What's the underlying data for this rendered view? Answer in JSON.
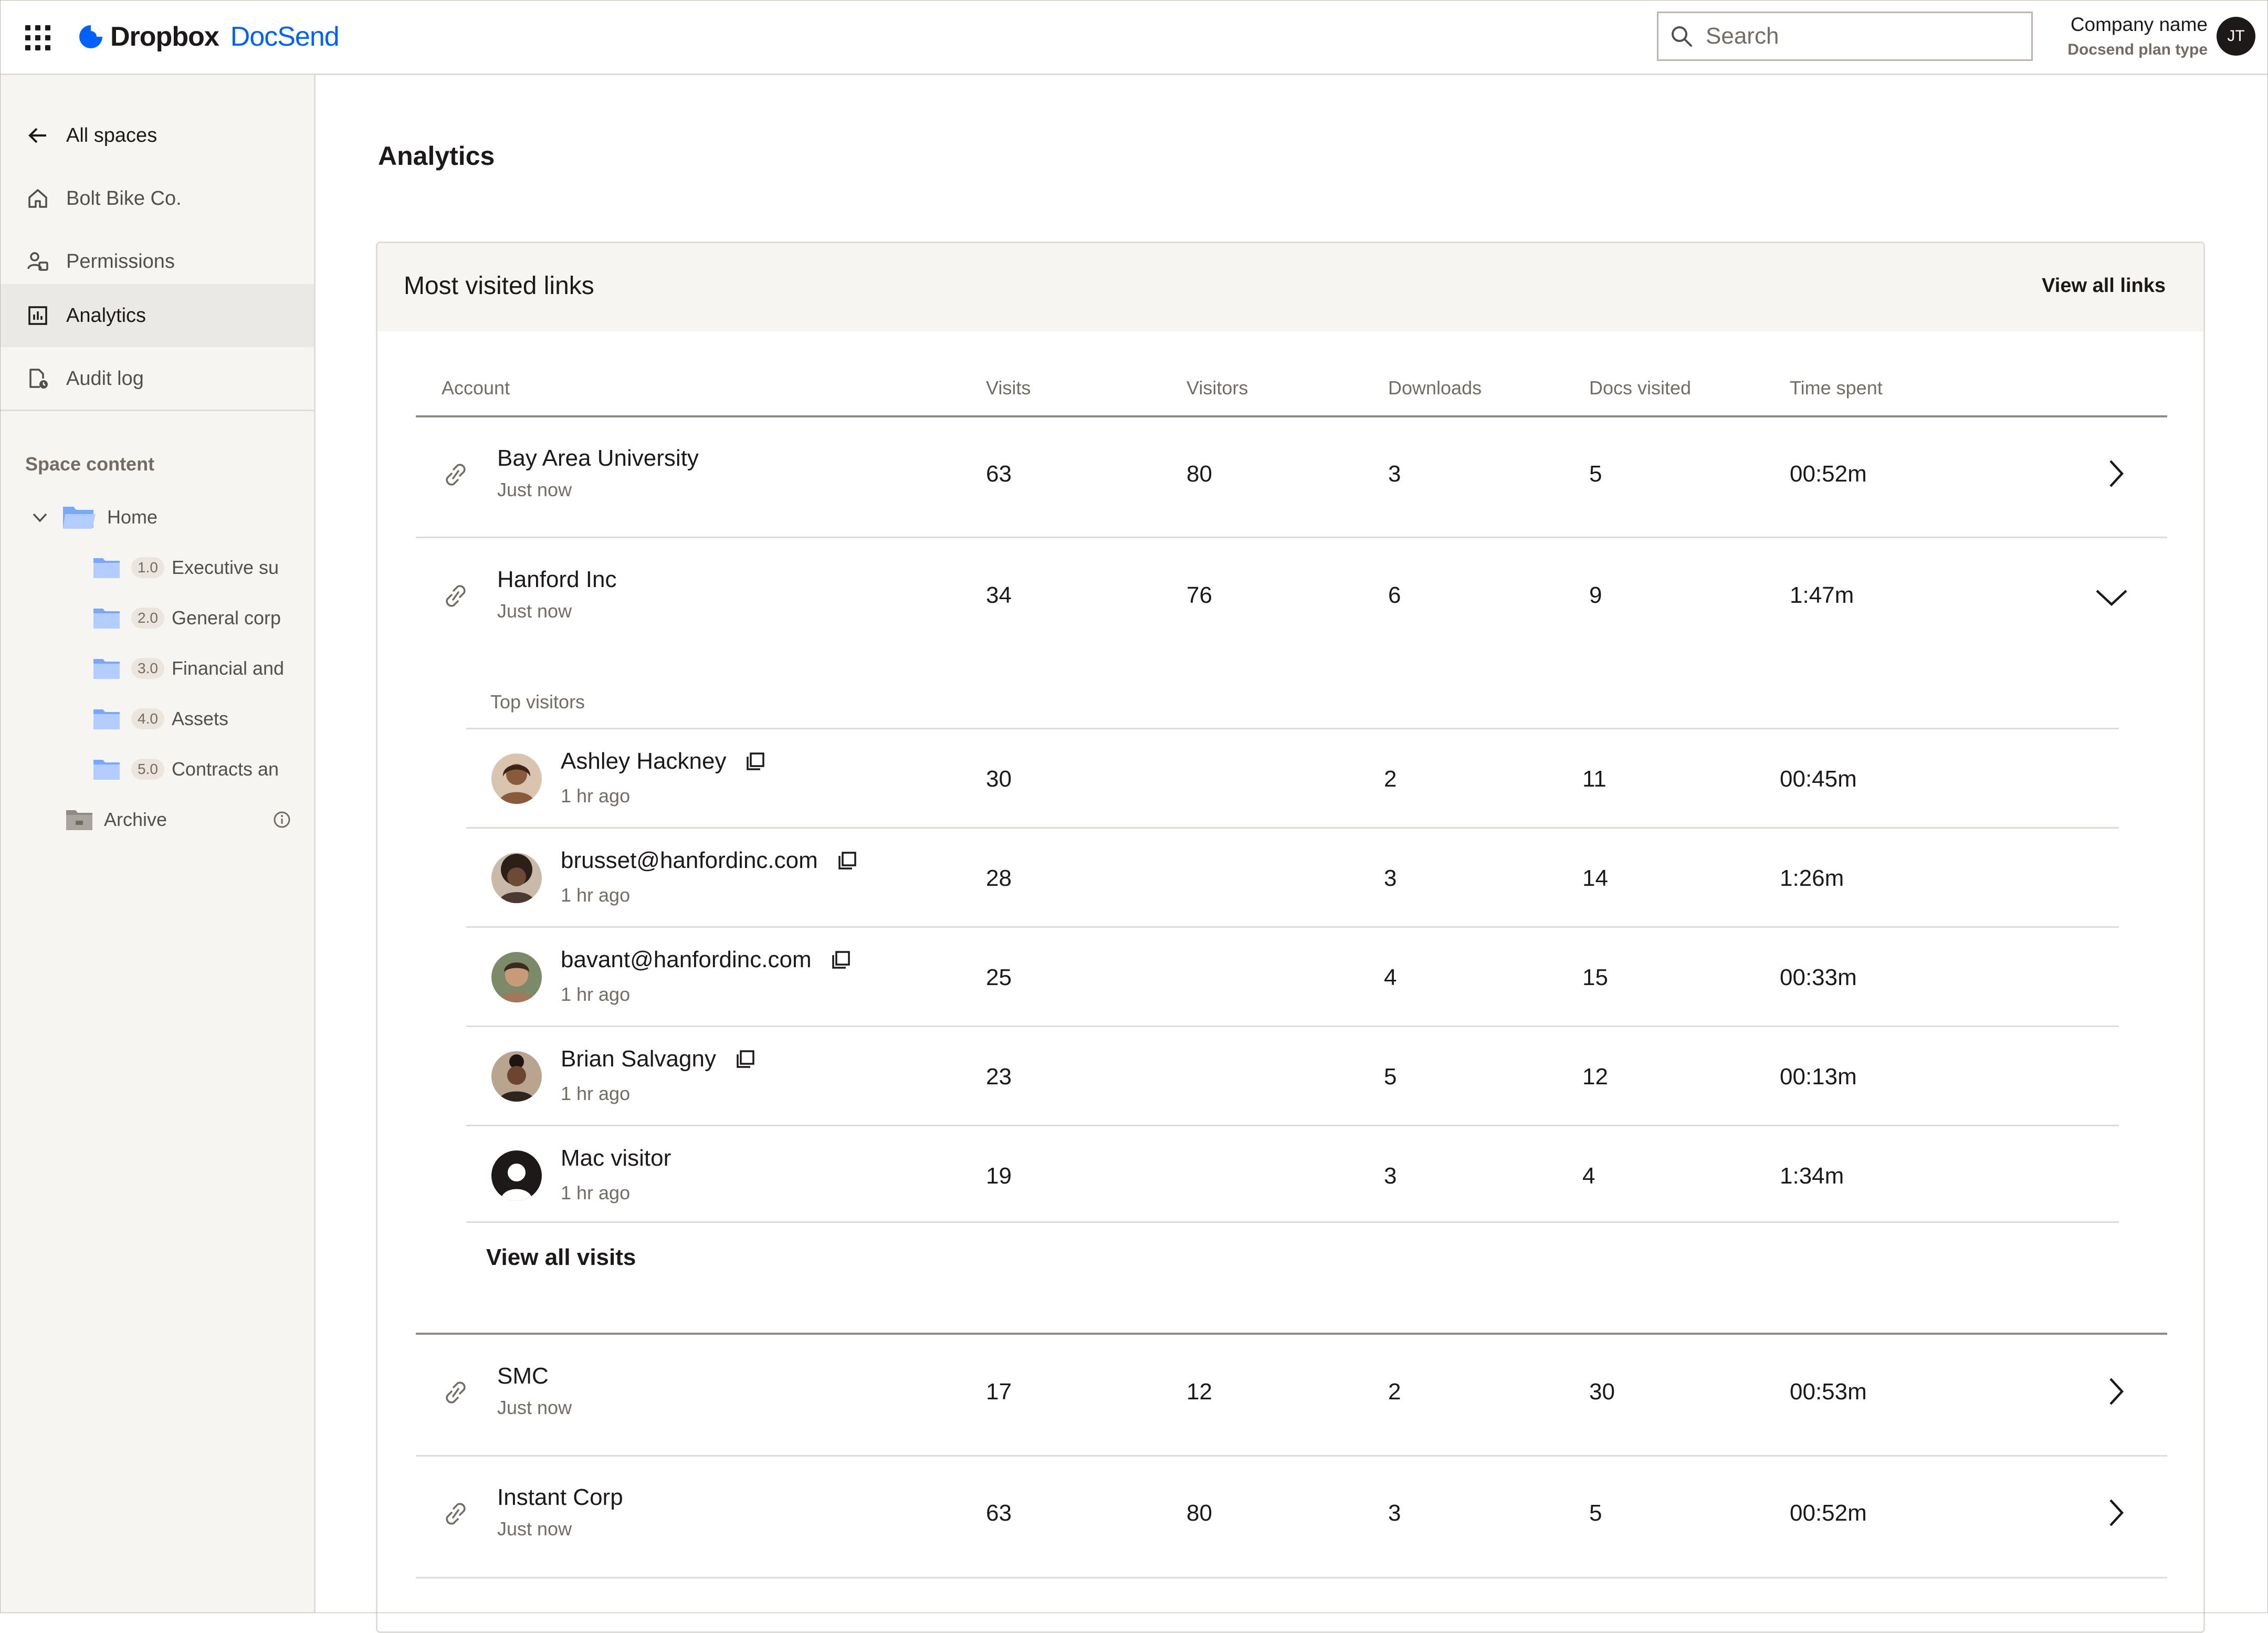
{
  "header": {
    "brand": "Dropbox",
    "product": "DocSend",
    "search_placeholder": "Search",
    "company_name": "Company name",
    "plan_type": "Docsend plan type",
    "user_initials": "JT",
    "brand_color": "#0061fe"
  },
  "sidebar": {
    "back_label": "All spaces",
    "items": [
      {
        "label": "Bolt Bike Co.",
        "icon": "home-icon"
      },
      {
        "label": "Permissions",
        "icon": "people-icon"
      },
      {
        "label": "Analytics",
        "icon": "chart-icon",
        "active": true
      },
      {
        "label": "Audit log",
        "icon": "document-clock-icon"
      }
    ],
    "space_content_title": "Space content",
    "home_label": "Home",
    "folders": [
      {
        "number": "1.0",
        "name": "Executive su"
      },
      {
        "number": "2.0",
        "name": "General corp"
      },
      {
        "number": "3.0",
        "name": "Financial and"
      },
      {
        "number": "4.0",
        "name": "Assets"
      },
      {
        "number": "5.0",
        "name": "Contracts an"
      }
    ],
    "archive_label": "Archive"
  },
  "main": {
    "title": "Analytics",
    "card_title": "Most visited links",
    "view_all_links": "View all links",
    "columns": [
      "Account",
      "Visits",
      "Visitors",
      "Downloads",
      "Docs visited",
      "Time spent"
    ],
    "accounts": [
      {
        "name": "Bay Area University",
        "sub": "Just now",
        "visits": "63",
        "visitors": "80",
        "downloads": "3",
        "docs": "5",
        "time": "00:52m",
        "expanded": false
      },
      {
        "name": "Hanford Inc",
        "sub": "Just now",
        "visits": "34",
        "visitors": "76",
        "downloads": "6",
        "docs": "9",
        "time": "1:47m",
        "expanded": true
      },
      {
        "name": "SMC",
        "sub": "Just now",
        "visits": "17",
        "visitors": "12",
        "downloads": "2",
        "docs": "30",
        "time": "00:53m",
        "expanded": false
      },
      {
        "name": "Instant Corp",
        "sub": "Just now",
        "visits": "63",
        "visitors": "80",
        "downloads": "3",
        "docs": "5",
        "time": "00:52m",
        "expanded": false
      }
    ],
    "top_visitors_label": "Top visitors",
    "visitors": [
      {
        "name": "Ashley Hackney",
        "sub": "1 hr ago",
        "visits": "30",
        "downloads": "2",
        "docs": "11",
        "time": "00:45m",
        "avatar_color": "#8a5a3c"
      },
      {
        "name": "brusset@hanfordinc.com",
        "sub": "1 hr ago",
        "visits": "28",
        "downloads": "3",
        "docs": "14",
        "time": "1:26m",
        "avatar_color": "#4a3a30"
      },
      {
        "name": "bavant@hanfordinc.com",
        "sub": "1 hr ago",
        "visits": "25",
        "downloads": "4",
        "docs": "15",
        "time": "00:33m",
        "avatar_color": "#a0785a"
      },
      {
        "name": "Brian Salvagny",
        "sub": "1 hr ago",
        "visits": "23",
        "downloads": "5",
        "docs": "12",
        "time": "00:13m",
        "avatar_color": "#6b4530"
      },
      {
        "name": "Mac visitor",
        "sub": "1 hr ago",
        "visits": "19",
        "downloads": "3",
        "docs": "4",
        "time": "1:34m",
        "avatar_color": "#1e1919"
      }
    ],
    "view_all_visits": "View all visits"
  }
}
